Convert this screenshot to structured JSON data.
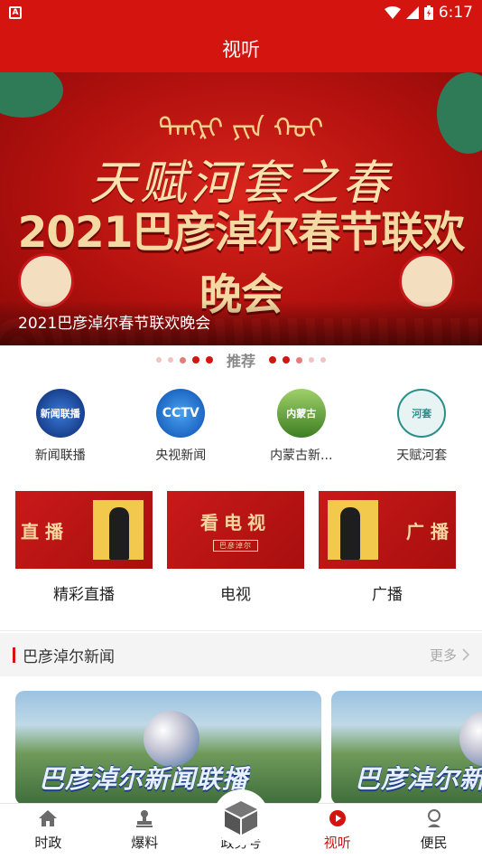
{
  "status_bar": {
    "time": "6:17",
    "notification_icon": "A"
  },
  "header": {
    "title": "视听"
  },
  "banner": {
    "mongolian_text": "ᠲᠡᠩᠷᠢ ᠶᠢᠨ ᠬᠣᠢ",
    "script_title": "天赋河套之春",
    "event_title": "2021巴彦淖尔春节联欢晚会",
    "caption": "2021巴彦淖尔春节联欢晚会"
  },
  "recommend": {
    "label": "推荐"
  },
  "channels": [
    {
      "name": "新闻联播",
      "logo_text": "新闻联播",
      "color": "#1e4fa8"
    },
    {
      "name": "央视新闻",
      "logo_text": "CCTV",
      "color": "#1b6fd0"
    },
    {
      "name": "内蒙古新...",
      "logo_text": "内蒙古",
      "color": "#4a8a2a"
    },
    {
      "name": "天赋河套",
      "logo_text": "河套",
      "color": "#2a8f8a"
    }
  ],
  "cards": [
    {
      "label": "精彩直播",
      "img_text": "直 播"
    },
    {
      "label": "电视",
      "img_text": "看电视",
      "img_sub": "巴彦淖尔"
    },
    {
      "label": "广播",
      "img_text": "广 播"
    }
  ],
  "section": {
    "title": "巴彦淖尔新闻",
    "more": "更多"
  },
  "news": [
    {
      "title": "巴彦淖尔新闻联播"
    },
    {
      "title": "巴彦淖尔新闻联播"
    }
  ],
  "tabs": [
    {
      "label": "时政",
      "icon": "home-icon"
    },
    {
      "label": "爆料",
      "icon": "stamp-icon"
    },
    {
      "label": "政务号",
      "icon": "cube-icon"
    },
    {
      "label": "视听",
      "icon": "play-icon"
    },
    {
      "label": "便民",
      "icon": "person-icon"
    }
  ],
  "colors": {
    "brand_red": "#d4140f"
  }
}
